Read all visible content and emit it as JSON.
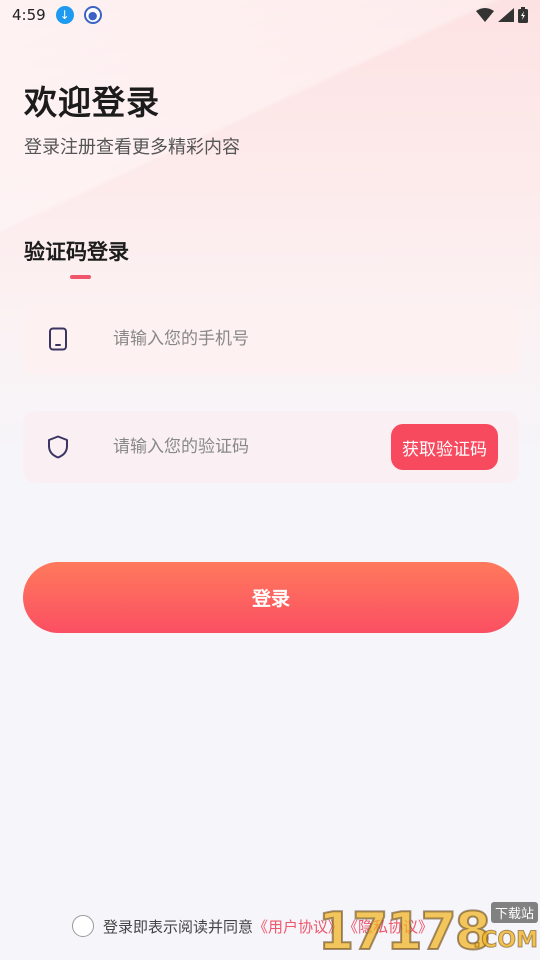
{
  "status_bar": {
    "time": "4:59",
    "icons": [
      "download-icon",
      "globe-icon",
      "wifi-icon",
      "signal-icon",
      "battery-icon"
    ]
  },
  "header": {
    "title": "欢迎登录",
    "subtitle": "登录注册查看更多精彩内容"
  },
  "tab": {
    "label": "验证码登录"
  },
  "phone_field": {
    "placeholder": "请输入您的手机号",
    "value": "",
    "icon": "phone-icon"
  },
  "code_field": {
    "placeholder": "请输入您的验证码",
    "value": "",
    "icon": "shield-icon",
    "button_label": "获取验证码"
  },
  "login_button": {
    "label": "登录"
  },
  "agreement": {
    "checked": false,
    "text": "登录即表示阅读并同意",
    "user_agreement": "《用户协议》",
    "privacy_policy": "《隐私协议》"
  },
  "watermark": {
    "number": "17178",
    "tag": "下载站",
    "suffix": ".COM"
  },
  "colors": {
    "accent": "#f84a5f",
    "button_gradient_top": "#ff7a5c",
    "button_gradient_bottom": "#fb4f63",
    "background": "#f6f5fa",
    "field_background": "#fdf1f2"
  }
}
